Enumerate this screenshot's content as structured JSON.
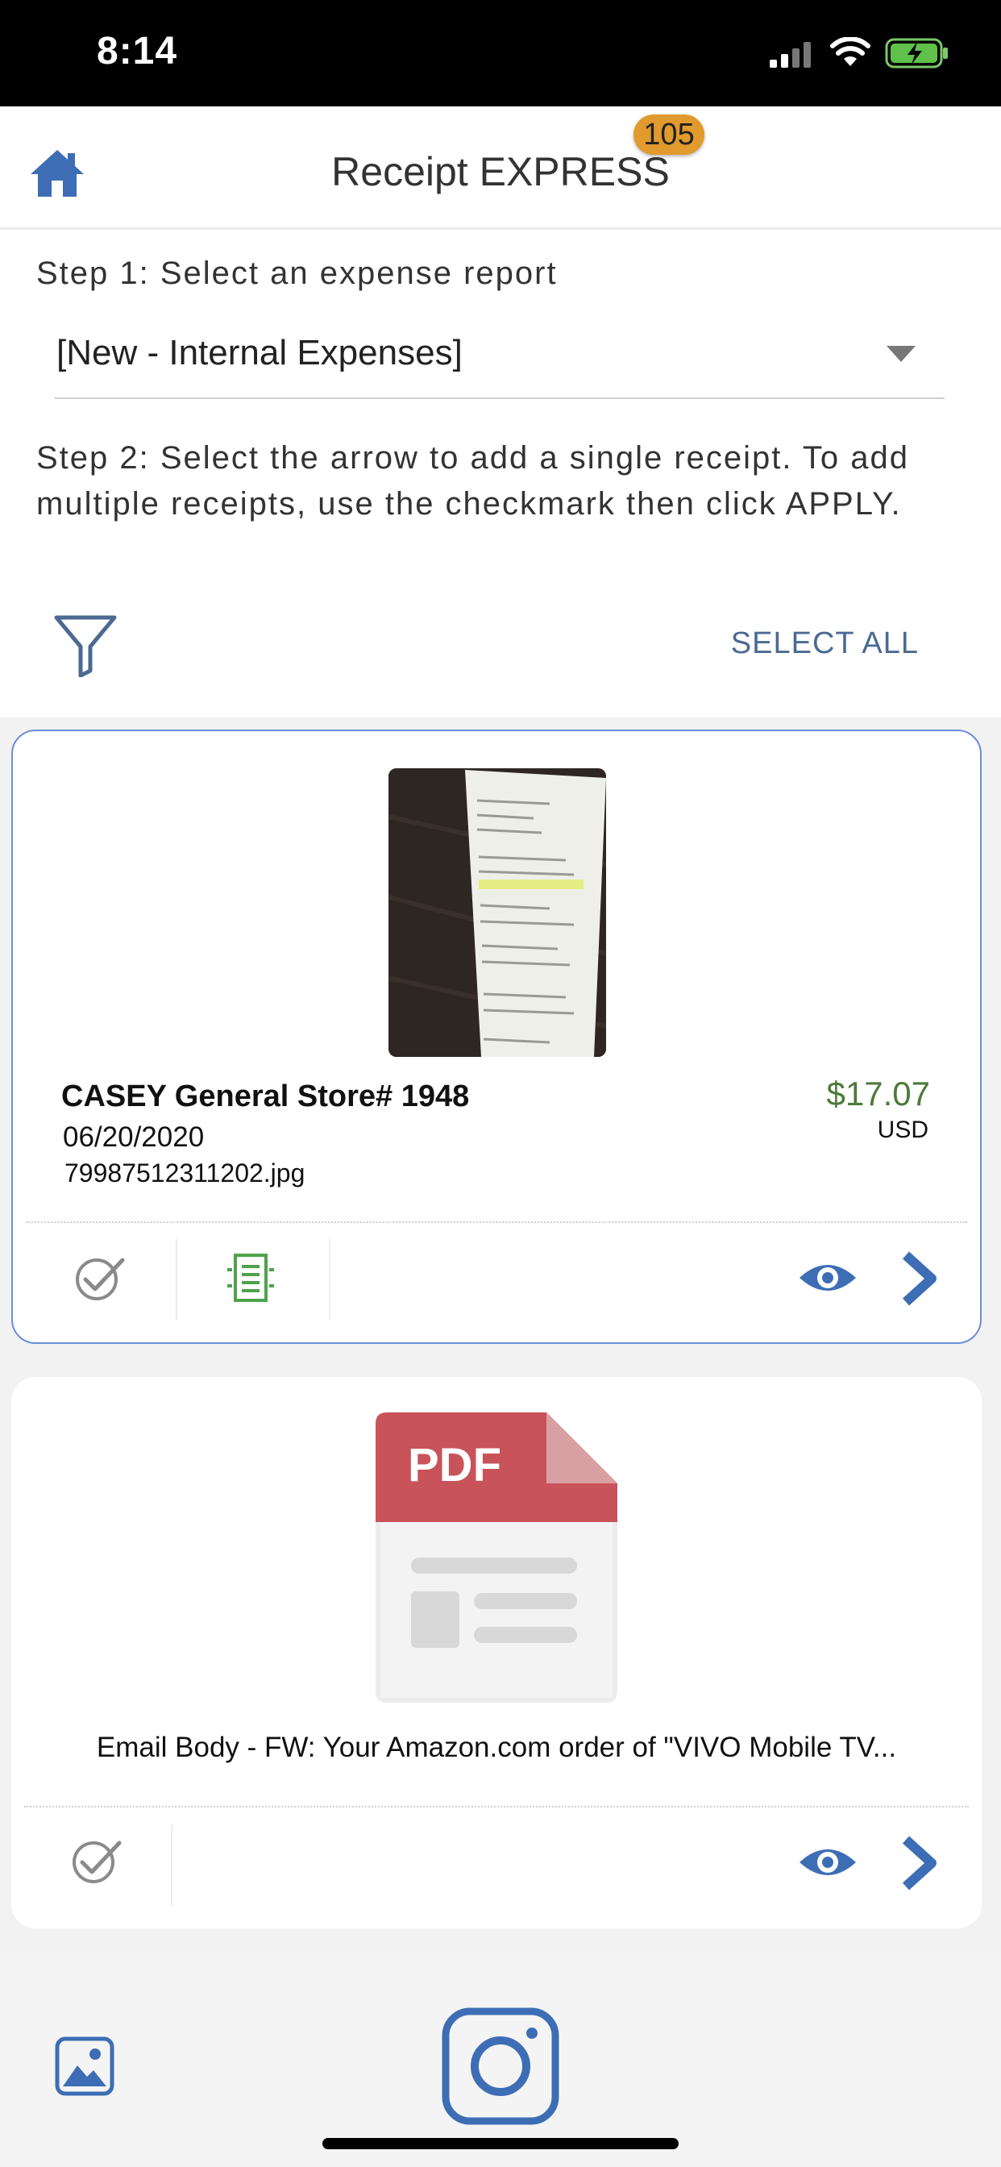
{
  "status_bar": {
    "time": "8:14"
  },
  "header": {
    "title": "Receipt EXPRESS",
    "badge_count": "105"
  },
  "steps": {
    "step1_label": "Step 1: Select an expense report",
    "report_selected": "[New - Internal Expenses]",
    "step2_label": "Step 2: Select the arrow to add a single receipt. To add multiple receipts, use the checkmark then click APPLY.",
    "select_all_label": "SELECT ALL"
  },
  "receipts": [
    {
      "vendor": "CASEY General Store# 1948",
      "date": "06/20/2020",
      "filename": "79987512311202.jpg",
      "amount": "$17.07",
      "currency": "USD"
    },
    {
      "title": "Email Body - FW: Your Amazon.com order of \"VIVO Mobile TV...",
      "file_type_label": "PDF"
    }
  ],
  "colors": {
    "accent_blue": "#3d6eb5",
    "amount_green": "#4d7a3b",
    "badge_orange": "#e09a2d",
    "pdf_red": "#c9535a"
  }
}
